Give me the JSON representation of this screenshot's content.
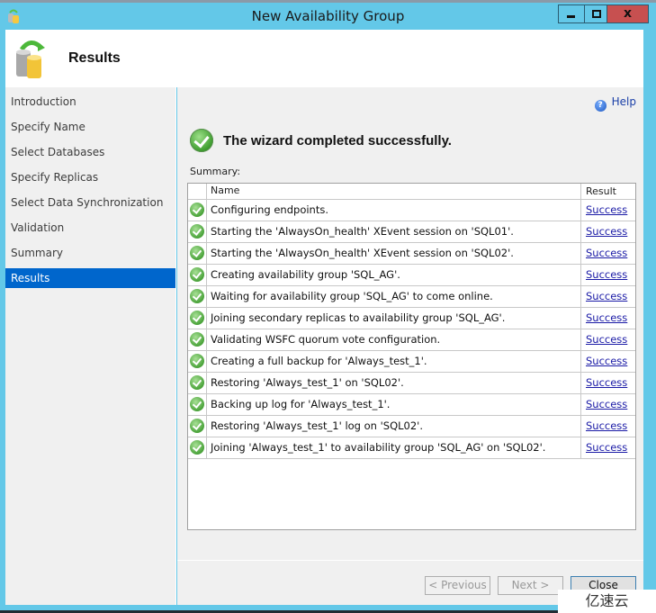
{
  "window": {
    "title": "New Availability Group",
    "controls": {
      "minimize": "minimize",
      "maximize": "maximize",
      "close": "x"
    }
  },
  "header": {
    "title": "Results"
  },
  "sidebar": {
    "items": [
      {
        "label": "Introduction",
        "active": false
      },
      {
        "label": "Specify Name",
        "active": false
      },
      {
        "label": "Select Databases",
        "active": false
      },
      {
        "label": "Specify Replicas",
        "active": false
      },
      {
        "label": "Select Data Synchronization",
        "active": false
      },
      {
        "label": "Validation",
        "active": false
      },
      {
        "label": "Summary",
        "active": false
      },
      {
        "label": "Results",
        "active": true
      }
    ]
  },
  "content": {
    "help_label": "Help",
    "success_message": "The wizard completed successfully.",
    "summary_label": "Summary:",
    "table": {
      "columns": [
        "Name",
        "Result"
      ],
      "rows": [
        {
          "name": "Configuring endpoints.",
          "result": "Success",
          "status_icon": "success-check"
        },
        {
          "name": "Starting the 'AlwaysOn_health' XEvent session on 'SQL01'.",
          "result": "Success",
          "status_icon": "success-check"
        },
        {
          "name": "Starting the 'AlwaysOn_health' XEvent session on 'SQL02'.",
          "result": "Success",
          "status_icon": "success-check"
        },
        {
          "name": "Creating availability group 'SQL_AG'.",
          "result": "Success",
          "status_icon": "success-check"
        },
        {
          "name": "Waiting for availability group 'SQL_AG' to come online.",
          "result": "Success",
          "status_icon": "success-check"
        },
        {
          "name": "Joining secondary replicas to availability group 'SQL_AG'.",
          "result": "Success",
          "status_icon": "success-check"
        },
        {
          "name": "Validating WSFC quorum vote configuration.",
          "result": "Success",
          "status_icon": "success-check"
        },
        {
          "name": "Creating a full backup for 'Always_test_1'.",
          "result": "Success",
          "status_icon": "success-check"
        },
        {
          "name": "Restoring 'Always_test_1' on 'SQL02'.",
          "result": "Success",
          "status_icon": "success-check"
        },
        {
          "name": "Backing up log for 'Always_test_1'.",
          "result": "Success",
          "status_icon": "success-check"
        },
        {
          "name": "Restoring 'Always_test_1' log on 'SQL02'.",
          "result": "Success",
          "status_icon": "success-check"
        },
        {
          "name": "Joining 'Always_test_1' to availability group 'SQL_AG' on 'SQL02'.",
          "result": "Success",
          "status_icon": "success-check"
        }
      ]
    }
  },
  "footer": {
    "previous_label": "< Previous",
    "next_label": "Next >",
    "close_label": "Close"
  },
  "watermark": "亿速云"
}
